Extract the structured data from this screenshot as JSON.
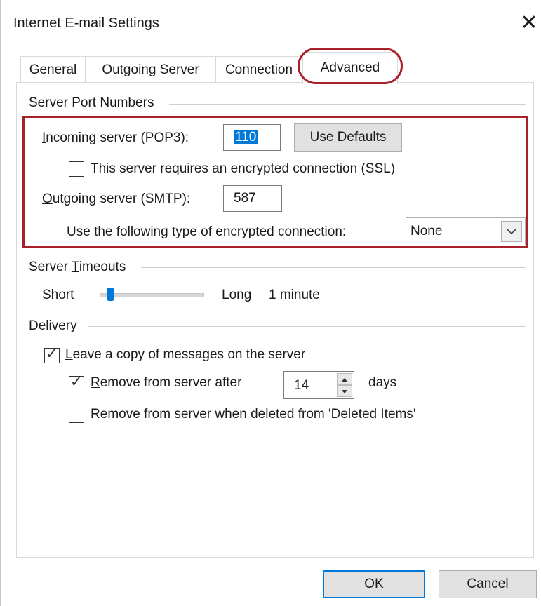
{
  "window": {
    "title": "Internet E-mail Settings",
    "close_glyph": "✕"
  },
  "tabs": [
    {
      "label": "General",
      "active": false
    },
    {
      "label": "Outgoing Server",
      "active": false
    },
    {
      "label": "Connection",
      "active": false
    },
    {
      "label": "Advanced",
      "active": true
    }
  ],
  "server_ports": {
    "group_label": "Server Port Numbers",
    "incoming_label": "Incoming server (POP3):",
    "incoming_value": "110",
    "use_defaults_label": "Use Defaults",
    "ssl_checkbox_label": "This server requires an encrypted connection (SSL)",
    "ssl_checked": false,
    "outgoing_label": "Outgoing server (SMTP):",
    "outgoing_value": "587",
    "encryption_label": "Use the following type of encrypted connection:",
    "encryption_value": "None"
  },
  "timeouts": {
    "group_label": "Server Timeouts",
    "short_label": "Short",
    "long_label": "Long",
    "value_text": "1 minute",
    "slider_level_fraction": 0.1
  },
  "delivery": {
    "group_label": "Delivery",
    "leave_copy_label": "Leave a copy of messages on the server",
    "leave_copy_checked": true,
    "remove_after_label": "Remove from server after",
    "remove_after_checked": true,
    "remove_after_days": "14",
    "days_label": "days",
    "remove_deleted_label": "Remove from server when deleted from 'Deleted Items'",
    "remove_deleted_checked": false
  },
  "buttons": {
    "ok": "OK",
    "cancel": "Cancel"
  },
  "colors": {
    "highlight_red": "#a8202a",
    "accent_blue": "#0078d7"
  },
  "icons": {
    "checkmark": "check-icon",
    "dropdown": "chevron-down-icon",
    "spin": "spin-arrows-icon"
  }
}
